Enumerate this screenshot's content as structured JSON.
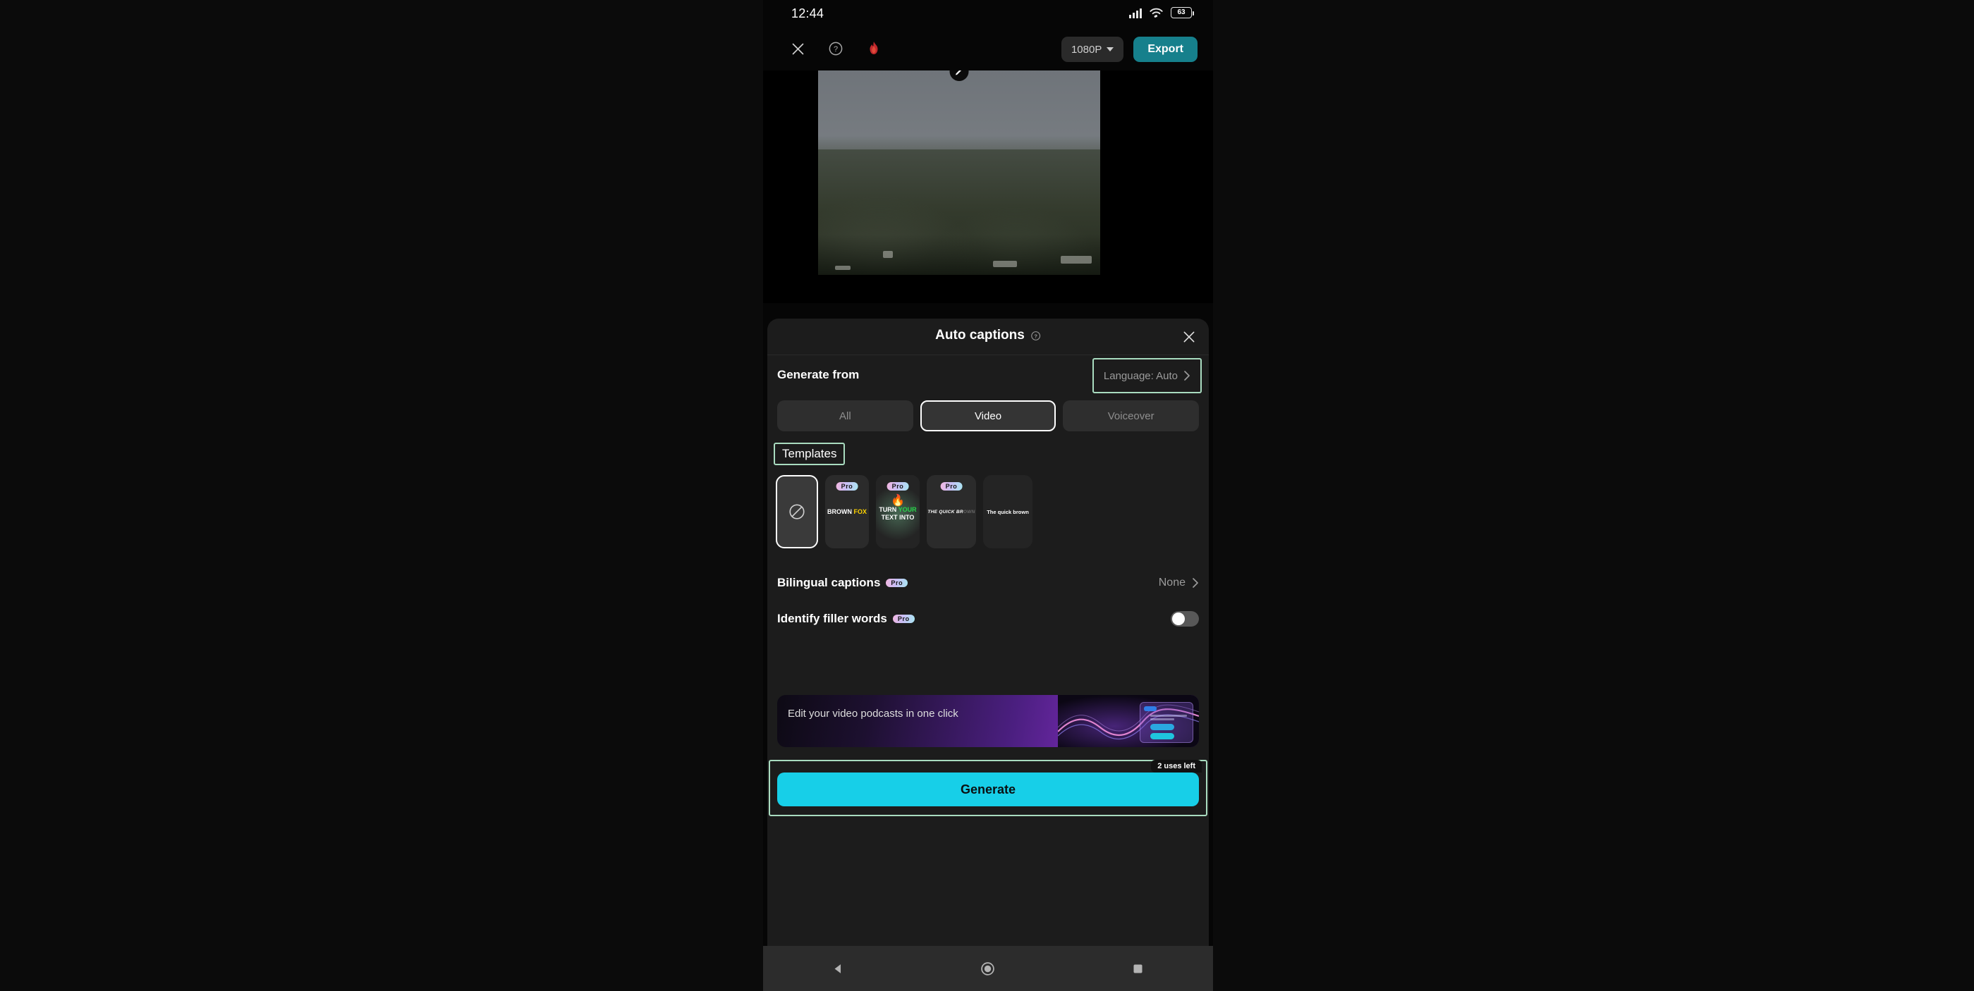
{
  "status_bar": {
    "time": "12:44",
    "battery": "63",
    "wifi_icon": "wifi-icon",
    "signal_icon": "cellular-signal-icon"
  },
  "toolbar": {
    "close_icon": "close-icon",
    "help_icon": "help-circle-icon",
    "flame_icon": "flame-icon",
    "resolution": "1080P",
    "export_label": "Export"
  },
  "preview": {
    "edit_icon": "edit-pencil-icon"
  },
  "sheet": {
    "title": "Auto captions",
    "title_help_icon": "help-circle-icon",
    "close_icon": "close-icon",
    "generate_from_label": "Generate from",
    "language_button": "Language: Auto",
    "language_chevron": "chevron-right-icon",
    "segments": [
      {
        "label": "All",
        "active": false
      },
      {
        "label": "Video",
        "active": true
      },
      {
        "label": "Voiceover",
        "active": false
      }
    ],
    "templates_label": "Templates",
    "templates": [
      {
        "name": "none",
        "icon": "no-template-icon",
        "pro": false,
        "selected": true
      },
      {
        "name": "brown-fox",
        "line1": "BROWN",
        "line2": "FOX",
        "pro": true,
        "pro_label": "Pro"
      },
      {
        "name": "turn-your-text-into",
        "line1": "TURN",
        "line2": "YOUR",
        "line3": "TEXT INTO",
        "flame": "🔥",
        "pro": true,
        "pro_label": "Pro"
      },
      {
        "name": "quick-brown-italic",
        "text": "THE QUICK BR",
        "text_fade": "OWN",
        "pro": true,
        "pro_label": "Pro"
      },
      {
        "name": "quick-brown-plain",
        "text": "The quick brown",
        "pro": false
      }
    ],
    "bilingual": {
      "label": "Bilingual captions",
      "pro_label": "Pro",
      "value": "None",
      "chevron": "chevron-right-icon"
    },
    "filler": {
      "label": "Identify filler words",
      "pro_label": "Pro",
      "toggle_state": "off"
    },
    "promo": {
      "text": "Edit your video podcasts in one click"
    },
    "generate": {
      "label": "Generate",
      "uses_badge": "2 uses left"
    }
  },
  "nav_bar": {
    "back_icon": "back-triangle-icon",
    "home_icon": "home-circle-icon",
    "recents_icon": "recents-square-icon"
  },
  "colors": {
    "accent_cyan": "#17cfe8",
    "export_teal": "#16808c",
    "highlight_green": "#a9dcc0",
    "sheet_bg": "#1c1c1c"
  }
}
